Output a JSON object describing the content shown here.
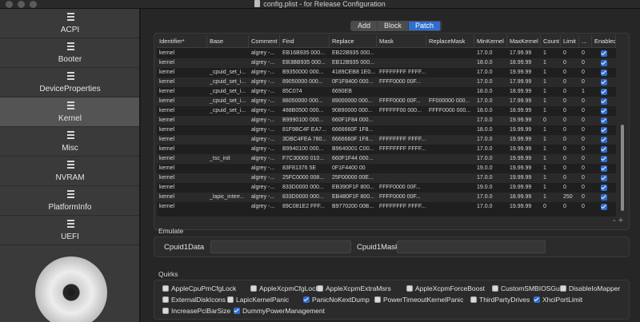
{
  "window": {
    "title": "config.plist - for Release Configuration"
  },
  "sidebar": {
    "items": [
      {
        "label": "ACPI",
        "icon": "list-icon"
      },
      {
        "label": "Booter",
        "icon": "list-icon"
      },
      {
        "label": "DeviceProperties",
        "icon": "list-icon"
      },
      {
        "label": "Kernel",
        "icon": "list-icon",
        "active": true
      },
      {
        "label": "Misc",
        "icon": "list-icon"
      },
      {
        "label": "NVRAM",
        "icon": "list-icon"
      },
      {
        "label": "PlatformInfo",
        "icon": "list-icon"
      },
      {
        "label": "UEFI",
        "icon": "list-icon"
      }
    ],
    "logo": "opencore-disc-logo"
  },
  "tabs": [
    {
      "label": "Add",
      "active": false
    },
    {
      "label": "Block",
      "active": false
    },
    {
      "label": "Patch",
      "active": true
    }
  ],
  "table": {
    "columns": [
      "Identifier*",
      "Base",
      "Comment",
      "Find",
      "Replace",
      "Mask",
      "ReplaceMask",
      "MinKernel",
      "MaxKernel",
      "Count",
      "Limit",
      "...",
      "Enabled"
    ],
    "rows": [
      [
        "kernel",
        "",
        "algrey -...",
        "EB16B935 000...",
        "EB22B935 000...",
        "",
        "",
        "17.0.0",
        "17.99.99",
        "1",
        "0",
        "0",
        true
      ],
      [
        "kernel",
        "",
        "algrey -...",
        "EB3BB935 000...",
        "EB12B935 000...",
        "",
        "",
        "18.0.0",
        "18.99.99",
        "1",
        "0",
        "0",
        true
      ],
      [
        "kernel",
        "_cpuid_set_i...",
        "algrey -...",
        "B9350000 000...",
        "4189CEB8 1E0...",
        "FFFFFFFF FFFF...",
        "",
        "17.0.0",
        "19.99.99",
        "1",
        "0",
        "0",
        true
      ],
      [
        "kernel",
        "_cpuid_set_i...",
        "algrey -...",
        "89050000 000...",
        "0F1F8400 000...",
        "FFFF0000 00F...",
        "",
        "17.0.0",
        "17.99.99",
        "1",
        "0",
        "0",
        true
      ],
      [
        "kernel",
        "_cpuid_set_i...",
        "algrey -...",
        "85C074",
        "6690EB",
        "",
        "",
        "18.0.0",
        "18.99.99",
        "1",
        "0",
        "1",
        true
      ],
      [
        "kernel",
        "_cpuid_set_i...",
        "algrey -...",
        "88050000 000...",
        "89000000 000...",
        "FFFF0000 00F...",
        "FF000000 000...",
        "17.0.0",
        "17.99.99",
        "1",
        "0",
        "0",
        true
      ],
      [
        "kernel",
        "_cpuid_set_i...",
        "algrey -...",
        "488B0500 000...",
        "90890000 000...",
        "FFFFFF00 000...",
        "FFFF0000 000...",
        "18.0.0",
        "18.99.99",
        "1",
        "0",
        "0",
        true
      ],
      [
        "kernel",
        "",
        "algrey -...",
        "B9990100 000...",
        "660F1F84 000...",
        "",
        "",
        "17.0.0",
        "19.99.99",
        "0",
        "0",
        "0",
        true
      ],
      [
        "kernel",
        "",
        "algrey -...",
        "81F9BC4F EA7...",
        "6666660F 1F8...",
        "",
        "",
        "18.0.0",
        "19.99.99",
        "1",
        "0",
        "0",
        true
      ],
      [
        "kernel",
        "",
        "algrey -...",
        "3DBC4FEA 780...",
        "6666660F 1F8...",
        "FFFFFFFF FFFF...",
        "",
        "17.0.0",
        "19.99.99",
        "1",
        "0",
        "0",
        true
      ],
      [
        "kernel",
        "",
        "algrey -...",
        "B9940100 000...",
        "B9640001 C00...",
        "FFFFFFFF FFFF...",
        "",
        "17.0.0",
        "19.99.99",
        "1",
        "0",
        "0",
        true
      ],
      [
        "kernel",
        "_tsc_init",
        "algrey -...",
        "F7C30000 010...",
        "660F1F44 000...",
        "",
        "",
        "17.0.0",
        "19.99.99",
        "1",
        "0",
        "0",
        true
      ],
      [
        "kernel",
        "",
        "algrey -...",
        "83F81376 5E",
        "0F1F4400 00",
        "",
        "",
        "19.0.0",
        "19.99.99",
        "1",
        "0",
        "0",
        true
      ],
      [
        "kernel",
        "",
        "algrey -...",
        "25FC0000 008...",
        "25F00000 00E...",
        "",
        "",
        "17.0.0",
        "19.99.99",
        "1",
        "0",
        "0",
        true
      ],
      [
        "kernel",
        "",
        "algrey -...",
        "833D0000 000...",
        "EB390F1F 800...",
        "FFFF0000 00F...",
        "",
        "19.0.0",
        "19.99.99",
        "1",
        "0",
        "0",
        true
      ],
      [
        "kernel",
        "_lapic_interr...",
        "algrey -...",
        "833D0000 000...",
        "EB480F1F 800...",
        "FFFF0000 00F...",
        "",
        "17.0.0",
        "18.99.99",
        "1",
        "250",
        "0",
        true
      ],
      [
        "kernel",
        "",
        "algrey -...",
        "89C081E2 FFF...",
        "B9770200 00B...",
        "FFFFFFFF FFFF...",
        "",
        "17.0.0",
        "19.99.99",
        "0",
        "0",
        "0",
        true
      ]
    ],
    "add_remove": "- +"
  },
  "emulate": {
    "section_label": "Emulate",
    "field1_label": "Cpuid1Data",
    "field1_value": "",
    "field2_label": "Cpuid1Mask",
    "field2_value": ""
  },
  "quirks": {
    "section_label": "Quirks",
    "items": [
      {
        "label": "AppleCpuPmCfgLock",
        "checked": false
      },
      {
        "label": "AppleXcpmCfgLock",
        "checked": false
      },
      {
        "label": "AppleXcpmExtraMsrs",
        "checked": false
      },
      {
        "label": "AppleXcpmForceBoost",
        "checked": false
      },
      {
        "label": "CustomSMBIOSGuid",
        "checked": false
      },
      {
        "label": "DisableIoMapper",
        "checked": false
      },
      {
        "label": "ExternalDiskIcons",
        "checked": false
      },
      {
        "label": "LapicKernelPanic",
        "checked": false
      },
      {
        "label": "PanicNoKextDump",
        "checked": true
      },
      {
        "label": "PowerTimeoutKernelPanic",
        "checked": false
      },
      {
        "label": "ThirdPartyDrives",
        "checked": false
      },
      {
        "label": "XhciPortLimit",
        "checked": true
      },
      {
        "label": "IncreasePciBarSize",
        "checked": false
      },
      {
        "label": "DummyPowerManagement",
        "checked": true
      }
    ]
  },
  "colors": {
    "accent": "#2f6ecf",
    "sidebar_active": "#545454"
  }
}
